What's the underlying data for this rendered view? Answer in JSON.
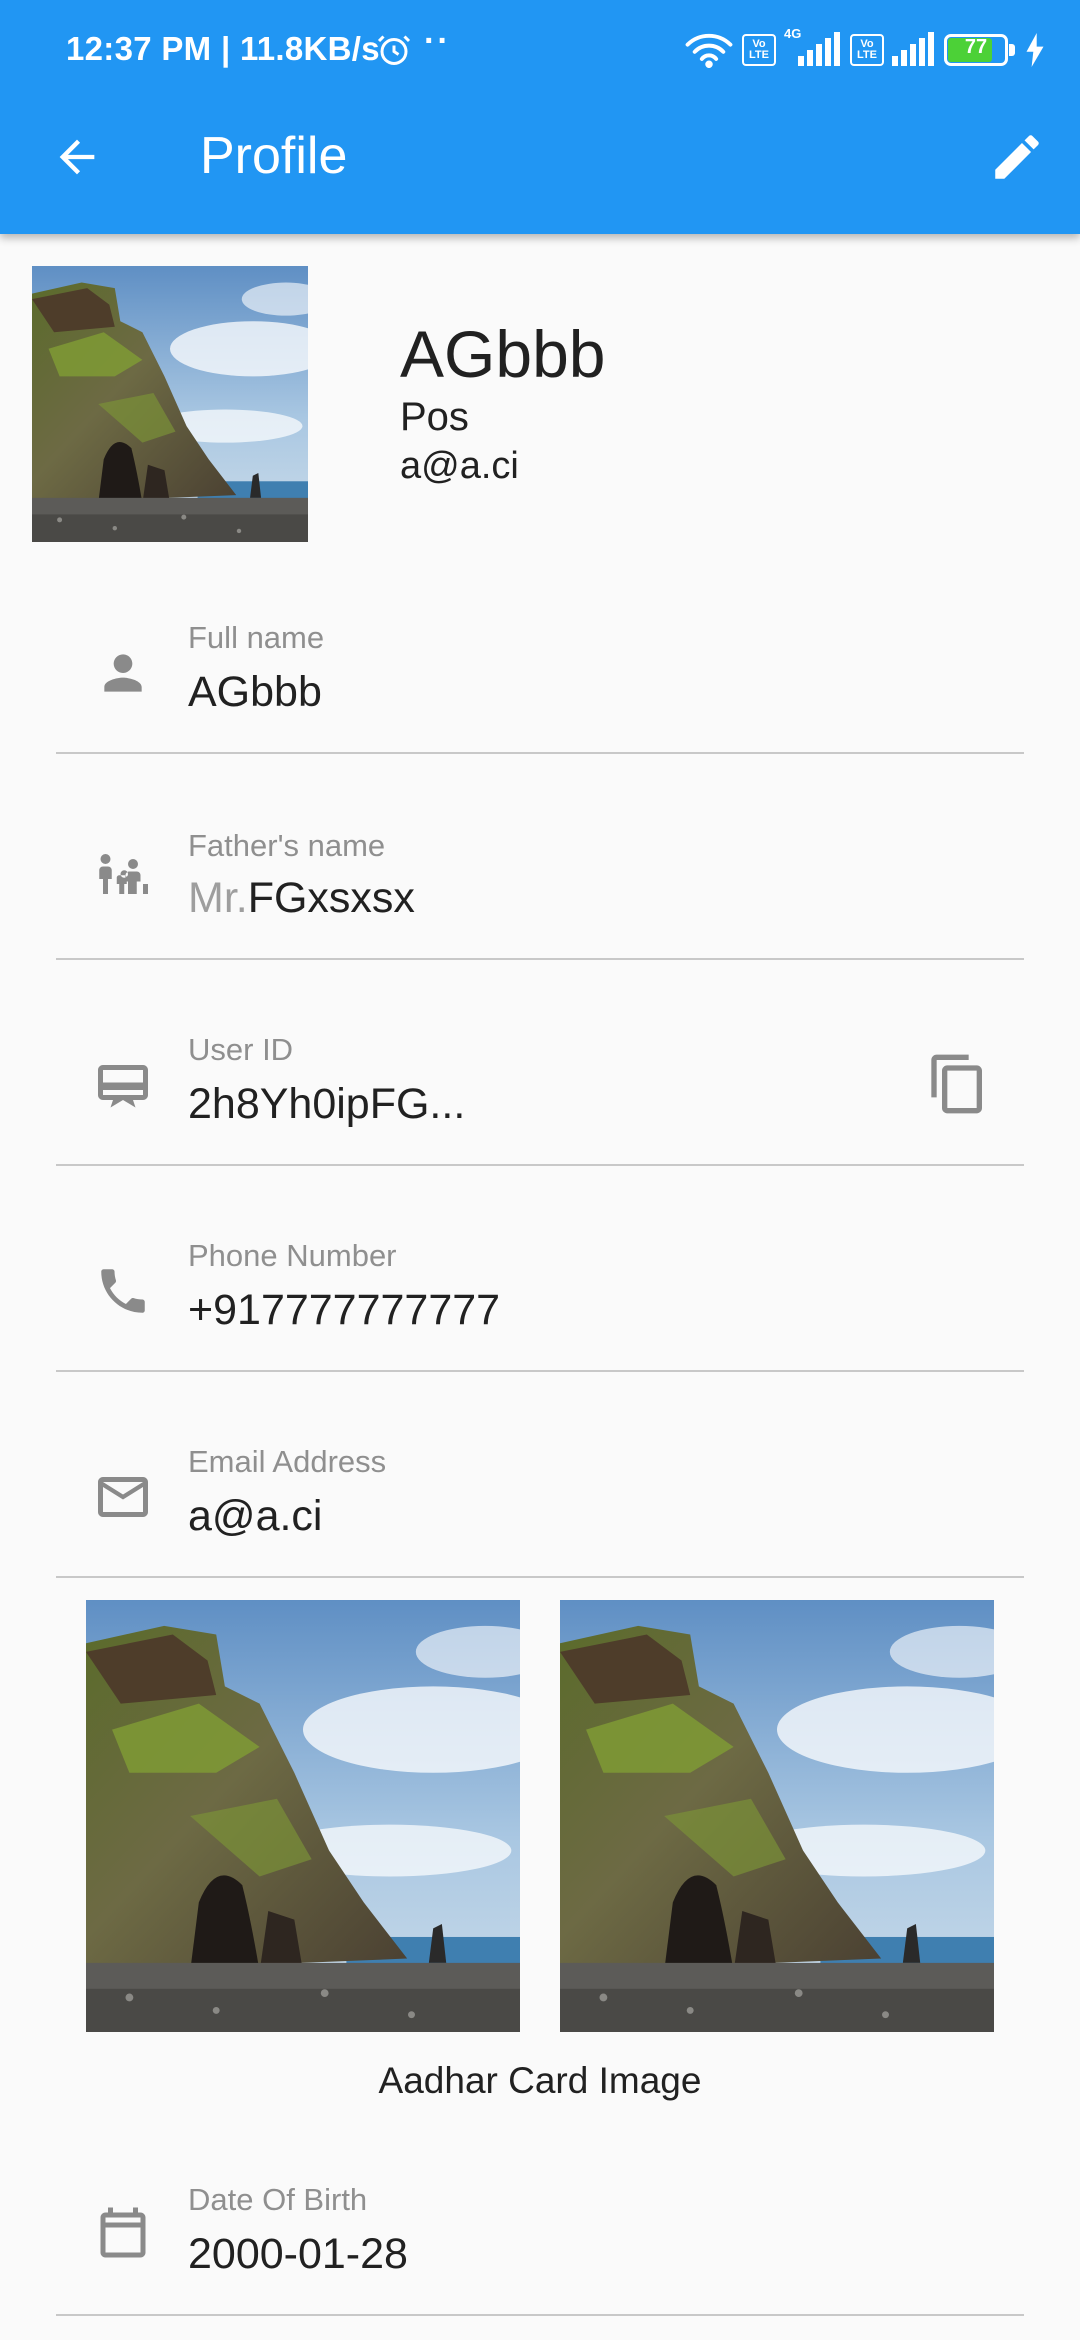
{
  "status_bar": {
    "time": "12:37 PM | 11.8KB/s",
    "extra": "··",
    "network_label": "4G",
    "volte_label": "Vo LTE",
    "battery_level": "77",
    "icons": [
      "alarm-icon",
      "wifi-icon",
      "volte-icon",
      "signal-icon",
      "battery-icon",
      "charging-icon"
    ]
  },
  "app_bar": {
    "title": "Profile",
    "back_icon": "arrow-back-icon",
    "edit_icon": "pencil-icon",
    "color": "#2196f3"
  },
  "header": {
    "name": "AGbbb",
    "position": "Pos",
    "email": "a@a.ci",
    "photo": "landscape-photo"
  },
  "fields": {
    "full_name": {
      "label": "Full name",
      "value": "AGbbb",
      "icon": "person-icon"
    },
    "father_name": {
      "label": "Father's name",
      "prefix": "Mr.",
      "value": "FGxsxsx",
      "icon": "family-icon"
    },
    "user_id": {
      "label": "User ID",
      "value": "2h8Yh0ipFG...",
      "icon": "id-card-icon",
      "action_icon": "copy-icon"
    },
    "phone": {
      "label": "Phone Number",
      "value": "+917777777777",
      "icon": "phone-icon"
    },
    "email": {
      "label": "Email Address",
      "value": "a@a.ci",
      "icon": "mail-icon"
    },
    "dob": {
      "label": "Date Of Birth",
      "value": "2000-01-28",
      "icon": "calendar-icon"
    }
  },
  "aadhar": {
    "caption": "Aadhar Card Image",
    "images": [
      "aadhar-front-image",
      "aadhar-back-image"
    ]
  }
}
